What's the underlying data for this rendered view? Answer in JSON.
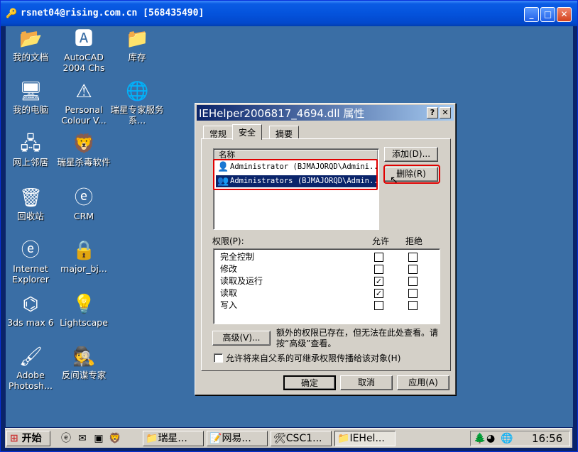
{
  "outer_window": {
    "title": "rsnet04@rising.com.cn [568435490]",
    "title_icon": "key-icon",
    "controls": {
      "minimize": "_",
      "maximize": "□",
      "close": "✕"
    }
  },
  "desktop_icons": [
    {
      "id": "my-documents",
      "label": "我的文档",
      "icon": "folder-docs-icon",
      "glyph": "📂"
    },
    {
      "id": "autocad",
      "label": "AutoCAD 2004 Chs",
      "icon": "autocad-icon",
      "glyph": "🅰"
    },
    {
      "id": "inventory",
      "label": "库存",
      "icon": "folder-icon",
      "glyph": "📁"
    },
    {
      "id": "my-computer",
      "label": "我的电脑",
      "icon": "computer-icon",
      "glyph": "🖥"
    },
    {
      "id": "personal-colour",
      "label": "Personal Colour V...",
      "icon": "colour-icon",
      "glyph": "⚠"
    },
    {
      "id": "rising-expert",
      "label": "瑞星专家服务系...",
      "icon": "expert-icon",
      "glyph": "🌐"
    },
    {
      "id": "network",
      "label": "网上邻居",
      "icon": "network-icon",
      "glyph": "🖧"
    },
    {
      "id": "rising-av",
      "label": "瑞星杀毒软件",
      "icon": "lion-icon",
      "glyph": "🦁"
    },
    {
      "id": "recycle-bin",
      "label": "回收站",
      "icon": "recycle-bin-icon",
      "glyph": "🗑"
    },
    {
      "id": "crm",
      "label": "CRM",
      "icon": "ie-icon",
      "glyph": "ⓔ"
    },
    {
      "id": "ie",
      "label": "Internet Explorer",
      "icon": "ie-icon",
      "glyph": "ⓔ"
    },
    {
      "id": "major-bj",
      "label": "major_bj...",
      "icon": "network-drive-icon",
      "glyph": "🔒"
    },
    {
      "id": "3dsmax",
      "label": "3ds max 6",
      "icon": "3dsmax-icon",
      "glyph": "⌬"
    },
    {
      "id": "lightscape",
      "label": "Lightscape",
      "icon": "lightscape-icon",
      "glyph": "💡"
    },
    {
      "id": "photoshop",
      "label": "Adobe Photosh...",
      "icon": "photoshop-icon",
      "glyph": "🖌"
    },
    {
      "id": "anti-spyware",
      "label": "反间谍专家",
      "icon": "anti-spy-icon",
      "glyph": "🕵"
    }
  ],
  "dialog": {
    "title": "IEHelper2006817_4694.dll 属性",
    "help": "?",
    "close": "✕",
    "tabs": [
      "常规",
      "安全",
      "摘要"
    ],
    "names_header": "名称",
    "names": [
      "Administrator (BJMAJORQD\\Admini...",
      "Administrators (BJMAJORQD\\Admin..."
    ],
    "add_button": "添加(D)...",
    "remove_button": "删除(R)",
    "permissions_label": "权限(P):",
    "allow_label": "允许",
    "deny_label": "拒绝",
    "permissions": [
      {
        "name": "完全控制",
        "allow": false,
        "deny": false
      },
      {
        "name": "修改",
        "allow": false,
        "deny": false
      },
      {
        "name": "读取及运行",
        "allow": true,
        "deny": false
      },
      {
        "name": "读取",
        "allow": true,
        "deny": false
      },
      {
        "name": "写入",
        "allow": false,
        "deny": false
      }
    ],
    "advanced_button": "高级(V)...",
    "advanced_note": "额外的权限已存在，但无法在此处查看。请按“高级”查看。",
    "inherit_label": "允许将来自父系的可继承权限传播给该对象(H)",
    "ok": "确定",
    "cancel": "取消",
    "apply": "应用(A)"
  },
  "taskbar": {
    "start": "开始",
    "tasks": [
      "瑞星...",
      "网易...",
      "CSC1...",
      "IEHel..."
    ],
    "clock": "16:56"
  }
}
